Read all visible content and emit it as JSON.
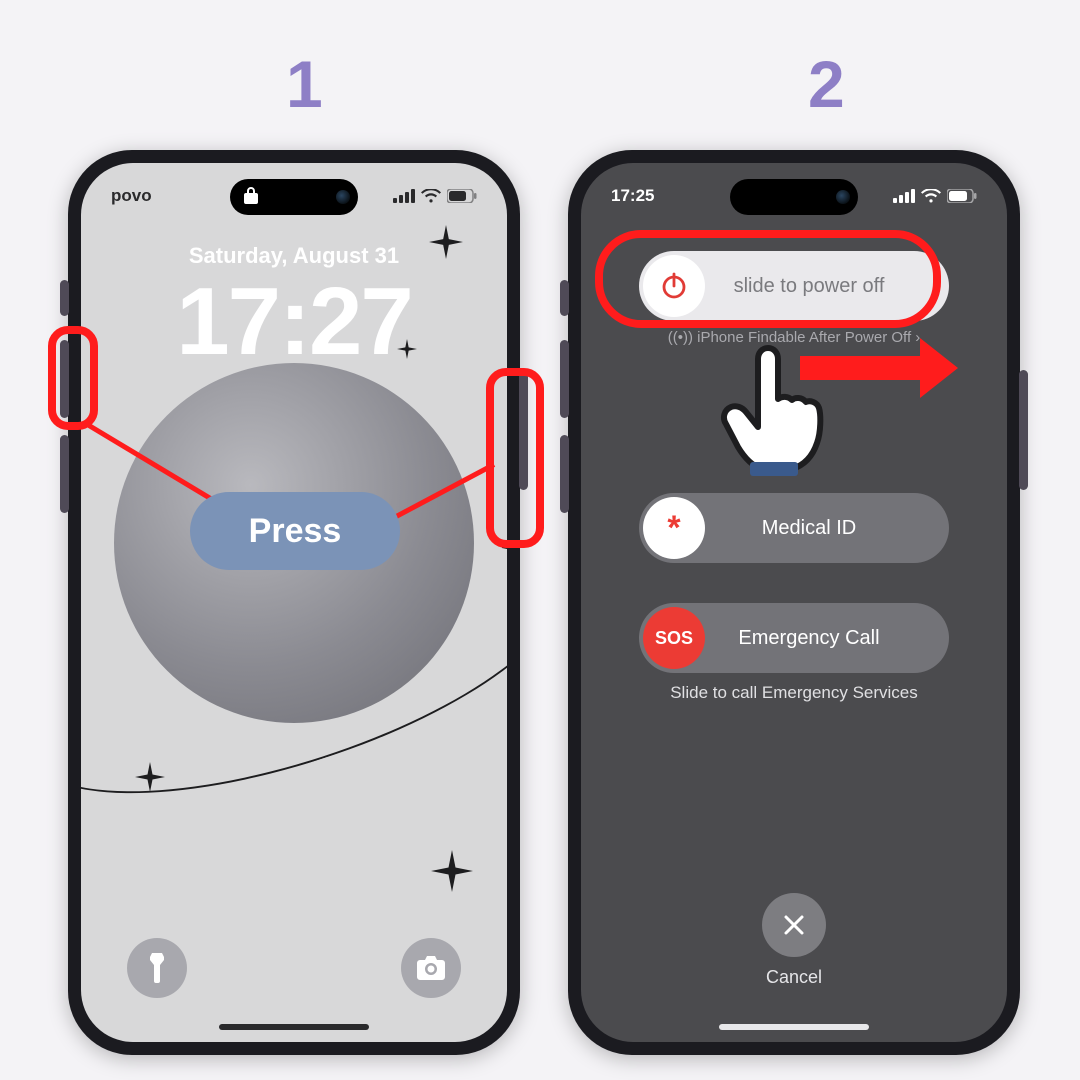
{
  "steps": {
    "one": "1",
    "two": "2"
  },
  "annotations": {
    "press": "Press"
  },
  "phone1": {
    "carrier": "povo",
    "date": "Saturday, August 31",
    "time": "17:27"
  },
  "phone2": {
    "time": "17:25",
    "power_off_label": "slide to power off",
    "findable": "iPhone Findable After Power Off",
    "medical_label": "Medical ID",
    "medical_symbol": "*",
    "sos_symbol": "SOS",
    "sos_label": "Emergency Call",
    "sos_hint": "Slide to call Emergency Services",
    "cancel": "Cancel"
  }
}
